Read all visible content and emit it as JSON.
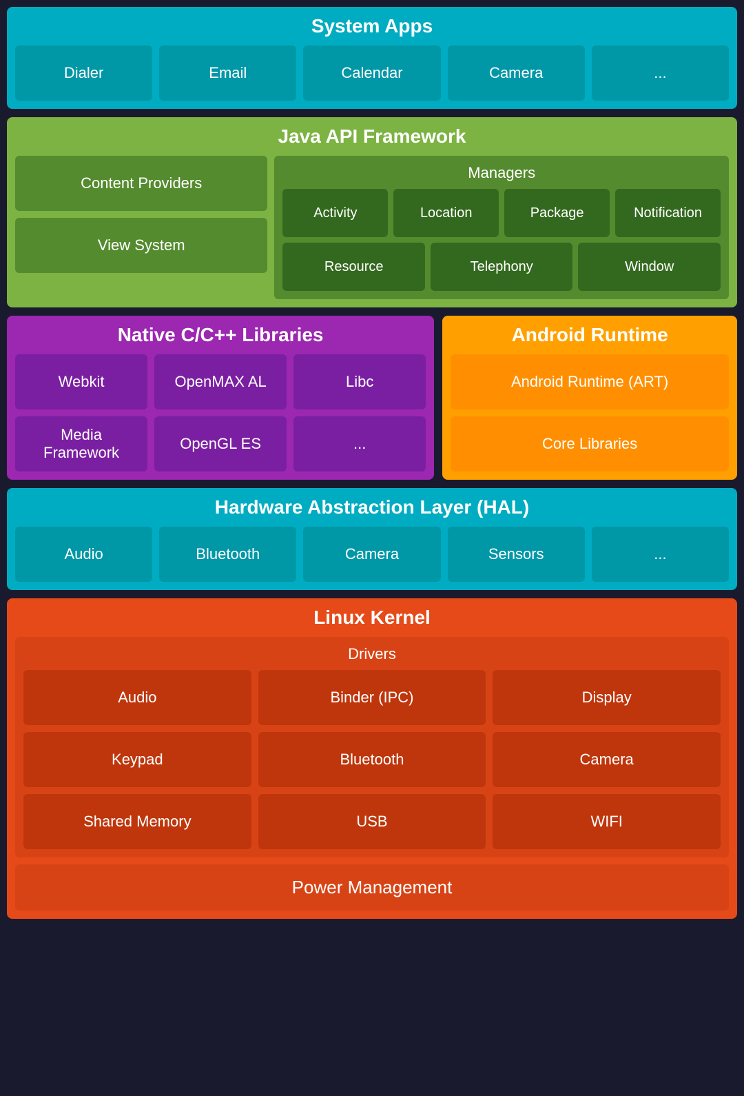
{
  "system_apps": {
    "title": "System Apps",
    "cells": [
      "Dialer",
      "Email",
      "Calendar",
      "Camera",
      "..."
    ]
  },
  "java_api": {
    "title": "Java API Framework",
    "left": [
      "Content Providers",
      "View System"
    ],
    "managers_title": "Managers",
    "managers_row1": [
      "Activity",
      "Location",
      "Package",
      "Notification"
    ],
    "managers_row2": [
      "Resource",
      "Telephony",
      "Window"
    ]
  },
  "native_cpp": {
    "title": "Native C/C++ Libraries",
    "row1": [
      "Webkit",
      "OpenMAX AL",
      "Libc"
    ],
    "row2": [
      "Media Framework",
      "OpenGL ES",
      "..."
    ]
  },
  "android_runtime": {
    "title": "Android Runtime",
    "cells": [
      "Android Runtime (ART)",
      "Core Libraries"
    ]
  },
  "hal": {
    "title": "Hardware Abstraction Layer (HAL)",
    "cells": [
      "Audio",
      "Bluetooth",
      "Camera",
      "Sensors",
      "..."
    ]
  },
  "linux_kernel": {
    "title": "Linux Kernel",
    "drivers_title": "Drivers",
    "drivers": [
      "Audio",
      "Binder (IPC)",
      "Display",
      "Keypad",
      "Bluetooth",
      "Camera",
      "Shared Memory",
      "USB",
      "WIFI"
    ],
    "power_management": "Power Management"
  }
}
